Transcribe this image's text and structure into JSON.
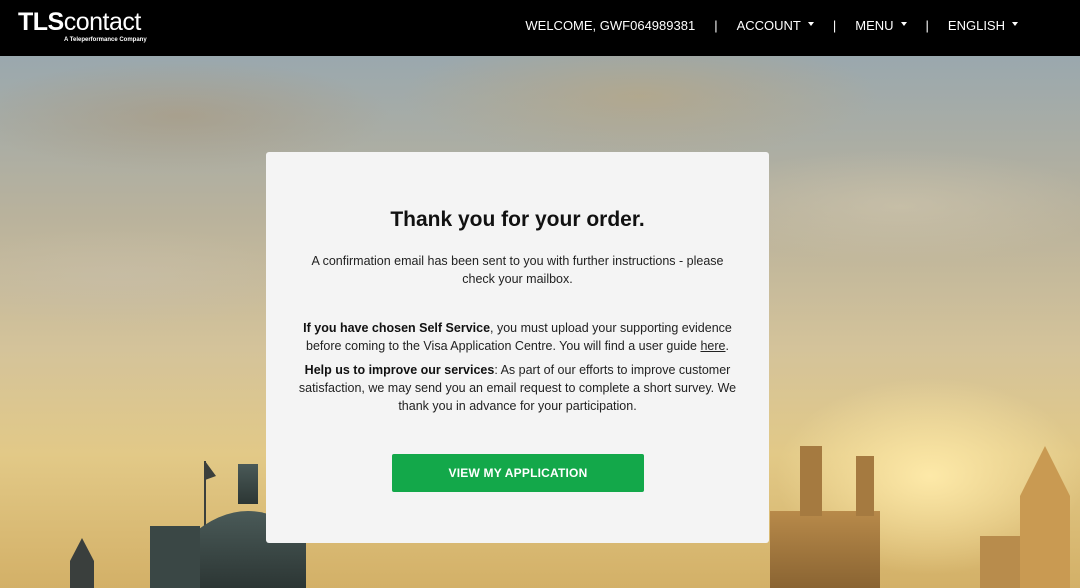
{
  "header": {
    "logo_main_a": "TLS",
    "logo_main_b": "contact",
    "logo_sub": "A Teleperformance Company",
    "welcome": "WELCOME, GWF064989381",
    "separator": "|",
    "account_label": "ACCOUNT",
    "menu_label": "MENU",
    "language_label": "ENGLISH"
  },
  "card": {
    "title": "Thank you for your order.",
    "confirmation": "A confirmation email has been sent to you with further instructions - please check your mailbox.",
    "self_service_bold": "If you have chosen Self Service",
    "self_service_text": ", you must upload your supporting evidence before coming to the Visa Application Centre. You will find a user guide ",
    "self_service_link": "here",
    "self_service_end": ".",
    "improve_bold": "Help us to improve our services",
    "improve_text": ": As part of our efforts to improve customer satisfaction, we may send you an email request to complete a short survey. We thank you in advance for your participation.",
    "button_label": "VIEW MY APPLICATION"
  },
  "colors": {
    "header_bg": "#000000",
    "button_green": "#13a84a",
    "card_bg": "#f4f4f4"
  }
}
